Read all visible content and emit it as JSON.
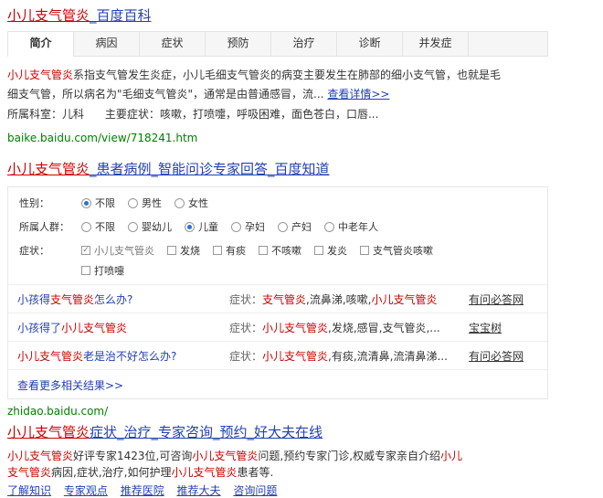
{
  "result1": {
    "title_hl": "小儿支气管炎",
    "title_rest": "_百度百科",
    "tabs": [
      "简介",
      "病因",
      "症状",
      "预防",
      "治疗",
      "诊断",
      "并发症"
    ],
    "abstract_hl": "小儿支气管炎",
    "abstract_line1": "系指支气管发生炎症，小儿毛细支气管炎的病变主要发生在肺部的细小支气管，也就是毛",
    "abstract_line2": "细支气管，所以病名为\"毛细支气管炎\"，通常是由普通感冒，流...",
    "see_more": "查看详情>>",
    "dept_label": "所属科室：",
    "dept_value": "儿科",
    "symptom_label": "主要症状：",
    "symptom_value": "咳嗽，打喷嚏，呼吸困难，面色苍白，口唇...",
    "url": "baike.baidu.com/view/718241.htm"
  },
  "result2": {
    "title_hl": "小儿支气管炎",
    "title_rest": "_患者病例_智能问诊专家回答_百度知道",
    "filters": {
      "gender_label": "性别：",
      "gender_options": [
        "不限",
        "男性",
        "女性"
      ],
      "gender_selected": 0,
      "group_label": "所属人群：",
      "group_options": [
        "不限",
        "婴幼儿",
        "儿童",
        "孕妇",
        "产妇",
        "中老年人"
      ],
      "group_selected": 2,
      "symptom_label": "症状：",
      "symptom_options": [
        "小儿支气管炎",
        "发烧",
        "有痰",
        "不咳嗽",
        "发炎",
        "支气管炎咳嗽",
        "打喷嚏"
      ]
    },
    "questions": [
      {
        "q_pre": "小孩得",
        "q_hl": "支气管炎",
        "q_post": "怎么办?",
        "s_label": "症状：",
        "s_hl1": "支气管炎",
        "s_mid": ",流鼻涕,咳嗽,",
        "s_hl2": "小儿支气管炎",
        "s_tail": "",
        "source": "有问必答网"
      },
      {
        "q_pre": "小孩得了",
        "q_hl": "小儿支气管炎",
        "q_post": "",
        "s_label": "症状：",
        "s_hl1": "小儿支气管炎",
        "s_mid": ",发烧,感冒,支气管炎,...",
        "s_hl2": "",
        "s_tail": "",
        "source": "宝宝树"
      },
      {
        "q_pre": "",
        "q_hl": "小儿支气管炎",
        "q_post": "老是治不好怎么办?",
        "s_label": "症状：",
        "s_hl1": "小儿支气管炎",
        "s_mid": ",有痰,流清鼻,流清鼻涕...",
        "s_hl2": "",
        "s_tail": "",
        "source": "有问必答网"
      }
    ],
    "more": "查看更多相关结果>>",
    "url": "zhidao.baidu.com/"
  },
  "result3": {
    "title_hl": "小儿支气管炎",
    "title_rest": "症状_治疗_专家咨询_预约_好大夫在线",
    "line1_hl1": "小儿支气管炎",
    "line1_mid": "好评专家1423位,可咨询",
    "line1_hl2": "小儿支气管炎",
    "line1_mid2": "问题,预约专家门诊,权威专家亲自介绍",
    "line1_hl3": "小儿",
    "line2_hl": "支气管炎",
    "line2_mid": "病因,症状,治疗,如何护理",
    "line2_hl2": "小儿支气管炎",
    "line2_tail": "患者等.",
    "links": [
      "了解知识",
      "专家观点",
      "推荐医院",
      "推荐大夫",
      "咨询问题"
    ]
  }
}
